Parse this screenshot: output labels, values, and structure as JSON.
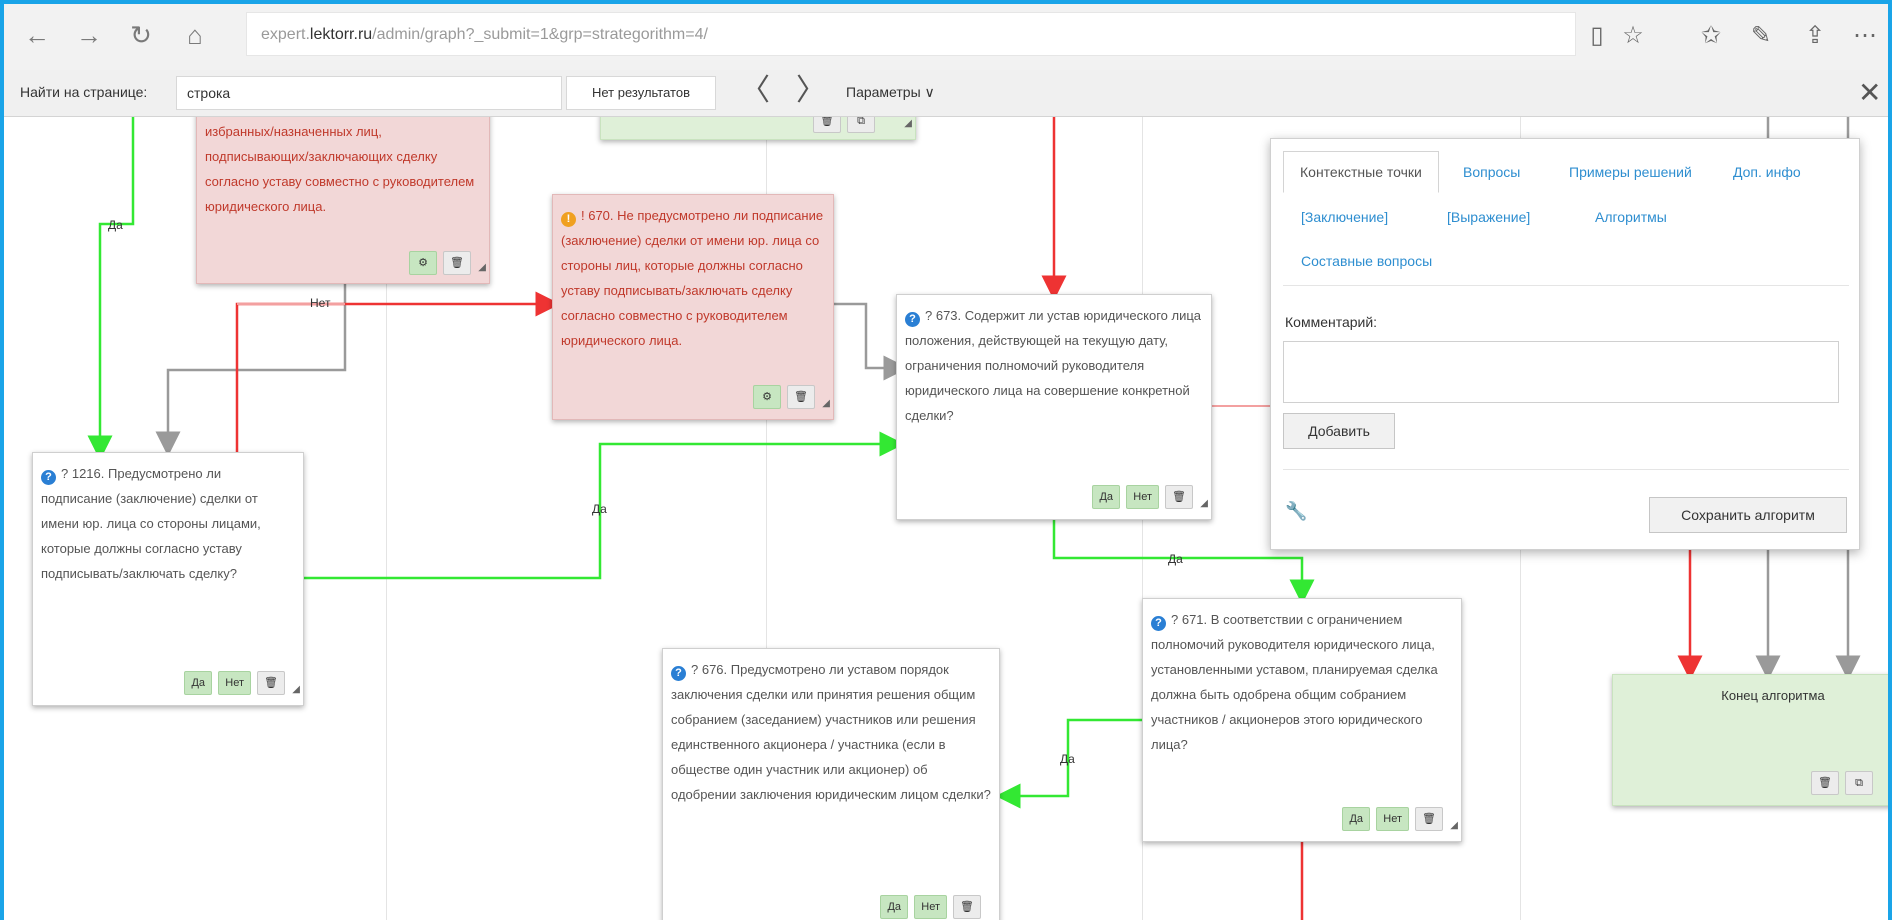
{
  "browser": {
    "back_icon": "←",
    "forward_icon": "→",
    "refresh_icon": "↻",
    "home_icon": "⌂",
    "url_prefix": "expert.",
    "url_domain": "lektorr.ru",
    "url_path": "/admin/graph?_submit=1&grp=strategorithm=4/",
    "reading_icon": "▯",
    "favorite_icon": "☆",
    "favorites_list_icon": "✩",
    "notes_icon": "✎",
    "share_icon": "⇪",
    "more_icon": "⋯"
  },
  "find_bar": {
    "label": "Найти на странице:",
    "query": "строка",
    "result": "Нет результатов",
    "prev_icon": "〈",
    "next_icon": "〉",
    "options": "Параметры ∨",
    "close_icon": "✕"
  },
  "nodes": {
    "n_top_left": {
      "text": "избранных/назначенных лиц, подписывающих/заключающих сделку согласно уставу совместно с руководителем юридического лица.",
      "btn_gear": "⚙",
      "btn_del": "🗑"
    },
    "n_top_mid": {
      "btn_del": "🗑",
      "btn_copy": "⧉"
    },
    "n_670": {
      "id": "! 670.",
      "text": "Не предусмотрено ли подписание (заключение) сделки от имени юр. лица со стороны лиц, которые должны согласно уставу подписывать/заключать сделку согласно совместно с руководителем юридического лица.",
      "btn_gear": "⚙",
      "btn_del": "🗑"
    },
    "n_673": {
      "id": "? 673.",
      "text": "Содержит ли устав юридического лица положения, действующей на текущую дату, ограничения полномочий руководителя юридического лица на совершение конкретной сделки?",
      "btn_yes": "Да",
      "btn_no": "Нет",
      "btn_del": "🗑"
    },
    "n_1216": {
      "id": "? 1216.",
      "text": "Предусмотрено ли подписание (заключение) сделки от имени юр. лица со стороны лицами, которые должны согласно уставу подписывать/заключать сделку?",
      "btn_yes": "Да",
      "btn_no": "Нет",
      "btn_del": "🗑"
    },
    "n_671": {
      "id": "? 671.",
      "text": "В соответствии с ограничением полномочий руководителя юридического лица, установленными уставом, планируемая сделка должна быть одобрена общим собранием участников / акционеров этого юридического лица?",
      "btn_yes": "Да",
      "btn_no": "Нет",
      "btn_del": "🗑"
    },
    "n_676": {
      "id": "? 676.",
      "text": "Предусмотрено ли уставом порядок заключения сделки или принятия решения общим собранием (заседанием) участников или решения единственного акционера / участника (если в обществе один участник или акционер) об одобрении заключения юридическим лицом сделки?",
      "btn_yes": "Да",
      "btn_no": "Нет",
      "btn_del": "🗑"
    },
    "n_end": {
      "text": "Конец алгоритма",
      "btn_del": "🗑",
      "btn_copy": "⧉"
    }
  },
  "edge_labels": {
    "yes": "Да",
    "no": "Нет"
  },
  "panel": {
    "tabs": [
      "Контекстные точки",
      "Вопросы",
      "Примеры решений",
      "Доп. инфо"
    ],
    "tabs2": [
      "[Заключение]",
      "[Выражение]",
      "Алгоритмы"
    ],
    "tab3": "Составные вопросы",
    "comment_label": "Комментарий:",
    "add_button": "Добавить",
    "settings_icon": "🔧",
    "save_button": "Сохранить алгоритм"
  },
  "colors": {
    "accent": "#1aa4e8",
    "yes_edge": "#33e833",
    "no_edge": "#ee3333",
    "neutral_edge": "#9a9a9a",
    "red_node": "#f2d7d7",
    "green_node": "#dff0d8"
  }
}
